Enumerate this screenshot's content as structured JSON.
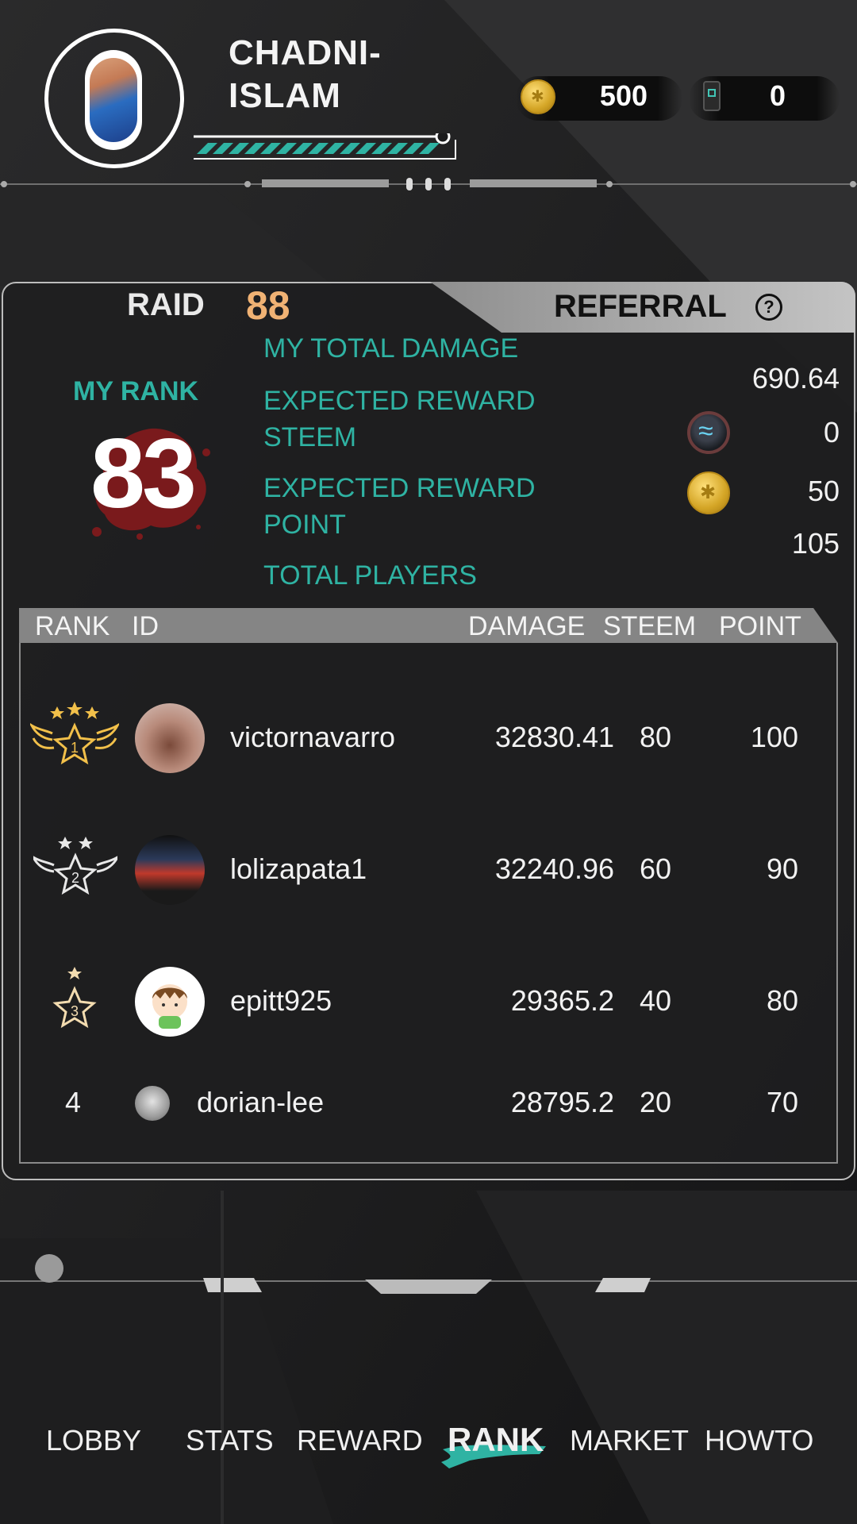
{
  "player": {
    "name": "CHADNI-ISLAM"
  },
  "currency": {
    "coins": "500",
    "tickets": "0"
  },
  "tabs": {
    "raid_label": "RAID",
    "raid_count": "88",
    "referral_label": "REFERRAL"
  },
  "my_rank": {
    "label": "MY RANK",
    "value": "83"
  },
  "stats": {
    "total_damage_label": "MY TOTAL DAMAGE",
    "total_damage_value": "690.64",
    "reward_steem_label": "EXPECTED REWARD STEEM",
    "reward_steem_value": "0",
    "reward_point_label": "EXPECTED REWARD POINT",
    "reward_point_value": "50",
    "total_players_label": "TOTAL PLAYERS",
    "total_players_value": "105"
  },
  "table": {
    "headers": {
      "rank": "RANK",
      "id": "ID",
      "damage": "DAMAGE",
      "steem": "STEEM",
      "point": "POINT"
    },
    "rows": [
      {
        "rank": "1",
        "id": "victornavarro",
        "damage": "32830.41",
        "steem": "80",
        "point": "100"
      },
      {
        "rank": "2",
        "id": "lolizapata1",
        "damage": "32240.96",
        "steem": "60",
        "point": "90"
      },
      {
        "rank": "3",
        "id": "epitt925",
        "damage": "29365.2",
        "steem": "40",
        "point": "80"
      },
      {
        "rank": "4",
        "id": "dorian-lee",
        "damage": "28795.2",
        "steem": "20",
        "point": "70"
      }
    ]
  },
  "nav": {
    "lobby": "LOBBY",
    "stats": "STATS",
    "reward": "REWARD",
    "rank": "RANK",
    "market": "MARKET",
    "howto": "HOWTO"
  },
  "colors": {
    "accent": "#2fb3a3",
    "raid_count": "#f0b274",
    "gold": "#d4a526"
  }
}
